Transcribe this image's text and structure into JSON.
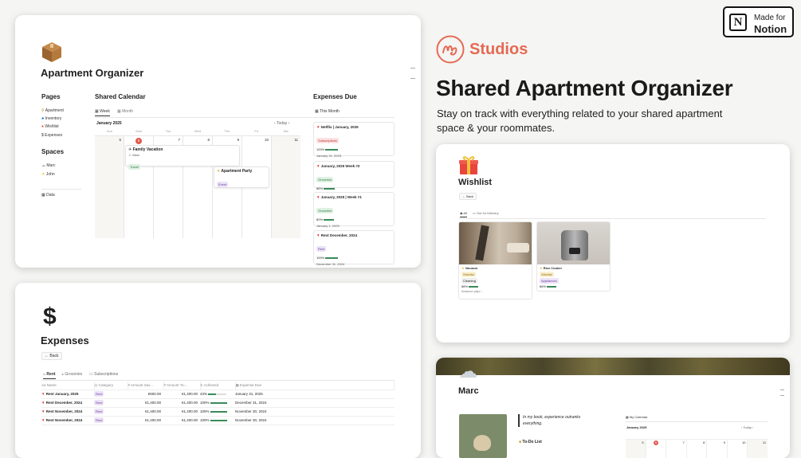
{
  "badge": {
    "line1": "Made for",
    "line2": "Notion"
  },
  "brand": {
    "name": "Studios"
  },
  "hero": {
    "title": "Shared Apartment Organizer",
    "subtitle1": "Stay on track with everything related to your shared apartment",
    "subtitle2": "space & your roommates."
  },
  "organizer": {
    "title": "Apartment Organizer",
    "pages_heading": "Pages",
    "pages": [
      "Apartment",
      "Inventory",
      "Wishlist",
      "Expenses"
    ],
    "spaces_heading": "Spaces",
    "spaces": [
      "Marc",
      "John"
    ],
    "data_label": "Data",
    "calendar": {
      "heading": "Shared Calendar",
      "view_week": "Week",
      "view_month": "Month",
      "month": "January 2025",
      "today": "Today",
      "days": [
        "Sun",
        "Mon",
        "Tue",
        "Wed",
        "Thu",
        "Fri",
        "Sat"
      ],
      "dates": [
        "5",
        "6",
        "7",
        "8",
        "9",
        "10",
        "11"
      ],
      "event1_title": "Family Vacation",
      "event1_person": "Marc",
      "event1_tag": "Travel",
      "event2_title": "Apartment Party",
      "event2_tag": "Event"
    },
    "expenses_due": {
      "heading": "Expenses Due",
      "filter": "This Month",
      "items": [
        {
          "title": "Netflix | January, 2025",
          "tag": "Subscriptions",
          "pct": "100%",
          "date": "January 31, 2025"
        },
        {
          "title": "January, 2025 Week #2",
          "tag": "Groceries",
          "pct": "86%",
          "date": ""
        },
        {
          "title": "January, 2025 | Week #1",
          "tag": "Groceries",
          "pct": "80%",
          "date": "January 1, 2025"
        },
        {
          "title": "Rent December, 2024",
          "tag": "Rent",
          "pct": "100%",
          "date": "December 31, 2024"
        }
      ]
    }
  },
  "expenses": {
    "title": "Expenses",
    "back": "Back",
    "tabs": [
      "Rent",
      "Groceries",
      "Subscriptions"
    ],
    "columns": [
      "Name",
      "Category",
      "Amount Sav...",
      "Amount To-...",
      "Achieved",
      "Expense Due"
    ],
    "rows": [
      [
        "Rent January, 2025",
        "Rent",
        "€600.00",
        "€1,400.00",
        "43%",
        "January 31, 2025"
      ],
      [
        "Rent December, 2024",
        "Rent",
        "€1,400.00",
        "€1,400.00",
        "100%",
        "December 31, 2024"
      ],
      [
        "Rent November, 2024",
        "Rent",
        "€1,400.00",
        "€1,400.00",
        "100%",
        "November 30, 2024"
      ],
      [
        "Rent November, 2024",
        "Rent",
        "€1,400.00",
        "€1,400.00",
        "100%",
        "November 30, 2024"
      ]
    ]
  },
  "wishlist": {
    "title": "Wishlist",
    "back": "Back",
    "tab_all": "All",
    "tab_delivery": "Out for Delivery",
    "items": [
      {
        "name": "Vacuum",
        "status": "Wishlist",
        "tag": "Cleaning",
        "pct": "86%",
        "note": "Amazon pdp/..."
      },
      {
        "name": "Rice Cooker",
        "status": "Wishlist",
        "tag": "Appliances",
        "pct": "86%"
      }
    ]
  },
  "marc": {
    "title": "Marc",
    "quote1": "In my book, experience outranks",
    "quote2": "everything.",
    "todo": "To-Do List",
    "calendar_label": "My Calendar",
    "month": "January 2025",
    "today": "Today",
    "dates": [
      "5",
      "6",
      "7",
      "8",
      "9",
      "10",
      "11"
    ]
  }
}
